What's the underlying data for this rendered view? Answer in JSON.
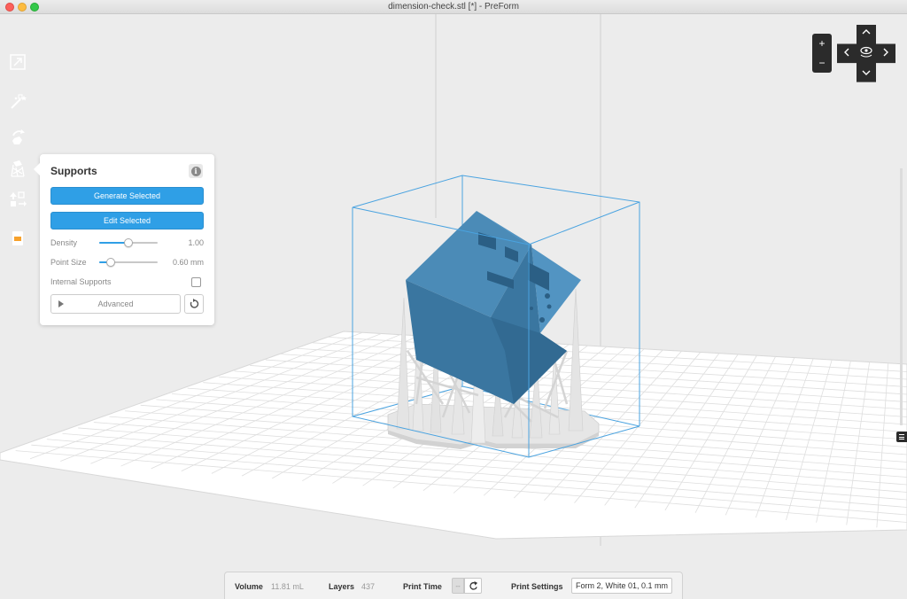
{
  "window": {
    "title": "dimension-check.stl [*] - PreForm"
  },
  "toolbar": {
    "tools": [
      {
        "name": "fit-view-tool",
        "icon": "expand-arrows-icon"
      },
      {
        "name": "one-click-print-tool",
        "icon": "magic-wand-icon"
      },
      {
        "name": "orientation-tool",
        "icon": "rotate-object-icon"
      },
      {
        "name": "supports-tool",
        "icon": "supports-icon"
      },
      {
        "name": "layout-tool",
        "icon": "layout-arrange-icon"
      },
      {
        "name": "print-tool",
        "icon": "printer-icon"
      }
    ],
    "accent": "#f7a12b"
  },
  "supports_panel": {
    "title": "Supports",
    "generate_label": "Generate Selected",
    "edit_label": "Edit Selected",
    "density_label": "Density",
    "density_value": "1.00",
    "density_fraction": 0.5,
    "point_size_label": "Point Size",
    "point_size_value": "0.60 mm",
    "point_size_fraction": 0.2,
    "internal_label": "Internal Supports",
    "internal_checked": false,
    "advanced_label": "Advanced"
  },
  "nav": {
    "zoom_in": "+",
    "zoom_out": "−"
  },
  "status_bar": {
    "volume_label": "Volume",
    "volume_value": "11.81 mL",
    "layers_label": "Layers",
    "layers_value": "437",
    "print_time_label": "Print Time",
    "print_time_value": "--",
    "print_settings_label": "Print Settings",
    "print_settings_value": "Form 2, White 01, 0.1 mm"
  },
  "colors": {
    "model": "#3d7eaa",
    "supports": "#e2e2e2",
    "bounding_box": "#4aa3e0",
    "button_blue": "#2f9fe6"
  }
}
